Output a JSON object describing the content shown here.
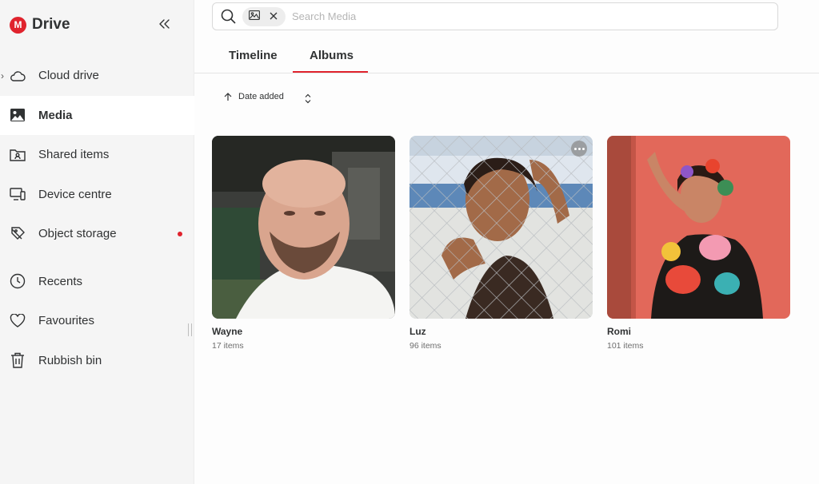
{
  "app": {
    "name": "Drive",
    "logo_letter": "M",
    "brand_color": "#e0232d"
  },
  "sidebar": {
    "items": [
      {
        "label": "Cloud drive",
        "icon": "cloud-icon"
      },
      {
        "label": "Media",
        "icon": "image-icon",
        "active": true
      },
      {
        "label": "Shared items",
        "icon": "shared-folder-icon"
      },
      {
        "label": "Device centre",
        "icon": "devices-icon"
      },
      {
        "label": "Object storage",
        "icon": "object-storage-icon",
        "badge": "dot"
      },
      {
        "label": "Recents",
        "icon": "clock-icon"
      },
      {
        "label": "Favourites",
        "icon": "heart-icon"
      },
      {
        "label": "Rubbish bin",
        "icon": "trash-icon"
      }
    ]
  },
  "search": {
    "placeholder": "Search Media",
    "filter_chip": "image-filter-icon"
  },
  "tabs": [
    {
      "label": "Timeline",
      "active": false
    },
    {
      "label": "Albums",
      "active": true
    }
  ],
  "sort": {
    "label": "Date added",
    "direction": "ascending"
  },
  "albums": [
    {
      "name": "Wayne",
      "count": "17 items"
    },
    {
      "name": "Luz",
      "count": "96 items"
    },
    {
      "name": "Romi",
      "count": "101 items"
    }
  ]
}
